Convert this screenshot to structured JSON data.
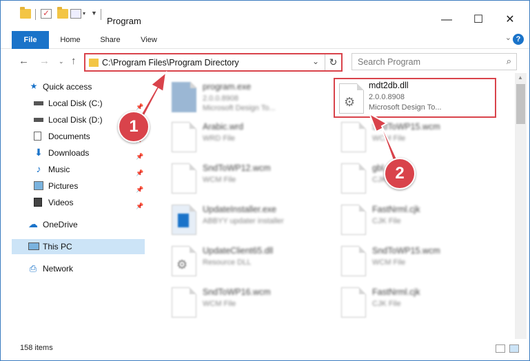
{
  "window": {
    "title": "Program"
  },
  "window_controls": {
    "minimize": "—",
    "maximize": "☐",
    "close": "✕"
  },
  "ribbon": {
    "tabs": [
      "File",
      "Home",
      "Share",
      "View"
    ]
  },
  "nav": {
    "address": "C:\\Program Files\\Program Directory",
    "search_placeholder": "Search Program"
  },
  "sidebar": {
    "items": [
      {
        "label": "Quick access",
        "icon": "star-icon"
      },
      {
        "label": "Local Disk (C:)",
        "icon": "drive-icon"
      },
      {
        "label": "Local Disk (D:)",
        "icon": "drive-icon"
      },
      {
        "label": "Documents",
        "icon": "documents-icon"
      },
      {
        "label": "Downloads",
        "icon": "download-icon"
      },
      {
        "label": "Music",
        "icon": "music-icon"
      },
      {
        "label": "Pictures",
        "icon": "pictures-icon"
      },
      {
        "label": "Videos",
        "icon": "videos-icon"
      },
      {
        "label": "OneDrive",
        "icon": "cloud-icon"
      },
      {
        "label": "This PC",
        "icon": "computer-icon"
      },
      {
        "label": "Network",
        "icon": "network-icon"
      }
    ]
  },
  "files": [
    {
      "name": "program.exe",
      "line2": "2.0.0.8908",
      "line3": "Microsoft Design To..."
    },
    {
      "name": "mdt2db.dll",
      "line2": "2.0.0.8908",
      "line3": "Microsoft Design To..."
    },
    {
      "name": "Arabic.wrd",
      "line2": "WRD File",
      "line3": ""
    },
    {
      "name": "SndToWP15.wcm",
      "line2": "WCM File",
      "line3": ""
    },
    {
      "name": "SndToWP12.wcm",
      "line2": "WCM File",
      "line3": ""
    },
    {
      "name": "gbl.cjk",
      "line2": "CJK File",
      "line3": ""
    },
    {
      "name": "UpdateInstaller.exe",
      "line2": "ABBYY updater installer",
      "line3": ""
    },
    {
      "name": "FastNrml.cjk",
      "line2": "CJK File",
      "line3": ""
    },
    {
      "name": "UpdateClient65.dll",
      "line2": "Resource DLL",
      "line3": ""
    },
    {
      "name": "SndToWP15.wcm",
      "line2": "WCM File",
      "line3": ""
    },
    {
      "name": "SndToWP16.wcm",
      "line2": "WCM File",
      "line3": ""
    },
    {
      "name": "FastNrml.cjk",
      "line2": "CJK File",
      "line3": ""
    }
  ],
  "status": {
    "item_count": "158 items"
  },
  "annotations": {
    "badge1": "1",
    "badge2": "2"
  },
  "colors": {
    "accent": "#1a73c9",
    "highlight": "#d9434b",
    "selected": "#cce4f7"
  }
}
